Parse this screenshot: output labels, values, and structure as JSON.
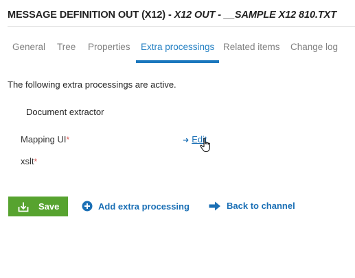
{
  "header": {
    "title_prefix": "MESSAGE DEFINITION OUT (X12) - ",
    "title_italic": "X12 OUT - __SAMPLE X12 810.TXT"
  },
  "tabs": [
    {
      "label": "General",
      "active": false
    },
    {
      "label": "Tree",
      "active": false
    },
    {
      "label": "Properties",
      "active": false
    },
    {
      "label": "Extra processings",
      "active": true
    },
    {
      "label": "Related items",
      "active": false
    },
    {
      "label": "Change log",
      "active": false
    }
  ],
  "content": {
    "intro": "The following extra processings are active.",
    "processing": {
      "title": "Document extractor",
      "fields": [
        {
          "label": "Mapping UI",
          "required_mark": "*"
        },
        {
          "label": "xslt",
          "required_mark": "*"
        }
      ],
      "edit_label": "Edit"
    }
  },
  "actions": {
    "save_label": "Save",
    "add_label": "Add extra processing",
    "back_label": "Back to channel"
  },
  "colors": {
    "accent": "#1a77bd",
    "link": "#1a6fb5",
    "save_bg": "#57a32f",
    "required": "#d9534f"
  },
  "icons": [
    "save-icon",
    "plus-circle-icon",
    "arrow-right-icon",
    "hand-cursor-icon"
  ]
}
